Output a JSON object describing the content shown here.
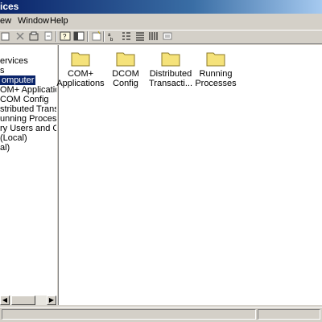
{
  "window": {
    "title": "ices"
  },
  "menu": {
    "items": [
      "ew",
      "Window",
      "Help"
    ]
  },
  "toolbar": {
    "icons": [
      "properties-icon",
      "cut-icon",
      "properties-sheet-icon",
      "export-icon",
      "help-icon",
      "mmc-icon",
      "new-window-icon",
      "large-icons-icon",
      "small-icons-icon",
      "list-icon",
      "details-icon",
      "view-options-icon"
    ]
  },
  "tree": {
    "items": [
      "ervices",
      "s",
      "omputer",
      "OM+ Applications",
      "COM Config",
      "stributed Transactic",
      "unning Processes",
      "ry Users and Comp",
      "(Local)",
      "al)"
    ],
    "selected_index": 2
  },
  "content": {
    "folders": [
      {
        "label_line1": "COM+",
        "label_line2": "Applications"
      },
      {
        "label_line1": "DCOM Config",
        "label_line2": ""
      },
      {
        "label_line1": "Distributed",
        "label_line2": "Transacti..."
      },
      {
        "label_line1": "Running",
        "label_line2": "Processes"
      }
    ]
  },
  "colors": {
    "selection": "#0a246a",
    "folder": "#f5e27a",
    "folder_outline": "#8c7a28",
    "title_bar": "#0a246a"
  }
}
